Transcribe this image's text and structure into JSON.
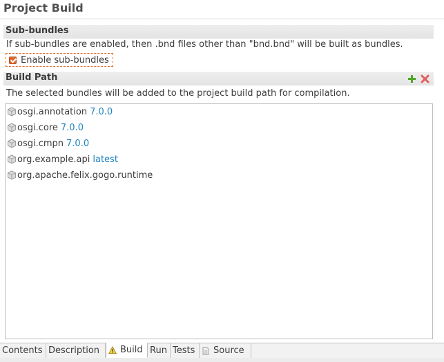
{
  "page": {
    "title": "Project Build"
  },
  "sub_bundles": {
    "title": "Sub-bundles",
    "description": "If sub-bundles are enabled, then .bnd files other than \"bnd.bnd\" will be built as bundles.",
    "checkbox_label": "Enable sub-bundles",
    "checked": true
  },
  "build_path": {
    "title": "Build Path",
    "description": "The selected bundles will be added to the project build path for compilation.",
    "add_icon": "add-icon",
    "remove_icon": "remove-icon",
    "bundles": [
      {
        "name": "osgi.annotation",
        "version": "7.0.0"
      },
      {
        "name": "osgi.core",
        "version": "7.0.0"
      },
      {
        "name": "osgi.cmpn",
        "version": "7.0.0"
      },
      {
        "name": "org.example.api",
        "version": "latest"
      },
      {
        "name": "org.apache.felix.gogo.runtime",
        "version": ""
      }
    ]
  },
  "tabs": [
    {
      "label": "Contents",
      "active": false
    },
    {
      "label": "Description",
      "active": false
    },
    {
      "label": "Build",
      "active": true,
      "icon": "warning-icon"
    },
    {
      "label": "Run",
      "active": false
    },
    {
      "label": "Tests",
      "active": false
    },
    {
      "label": "Source",
      "active": false,
      "icon": "document-icon"
    }
  ],
  "colors": {
    "version_link": "#1f84c0",
    "checkbox_accent": "#e06a2e",
    "add_green": "#4ea826",
    "remove_red": "#e06060"
  }
}
